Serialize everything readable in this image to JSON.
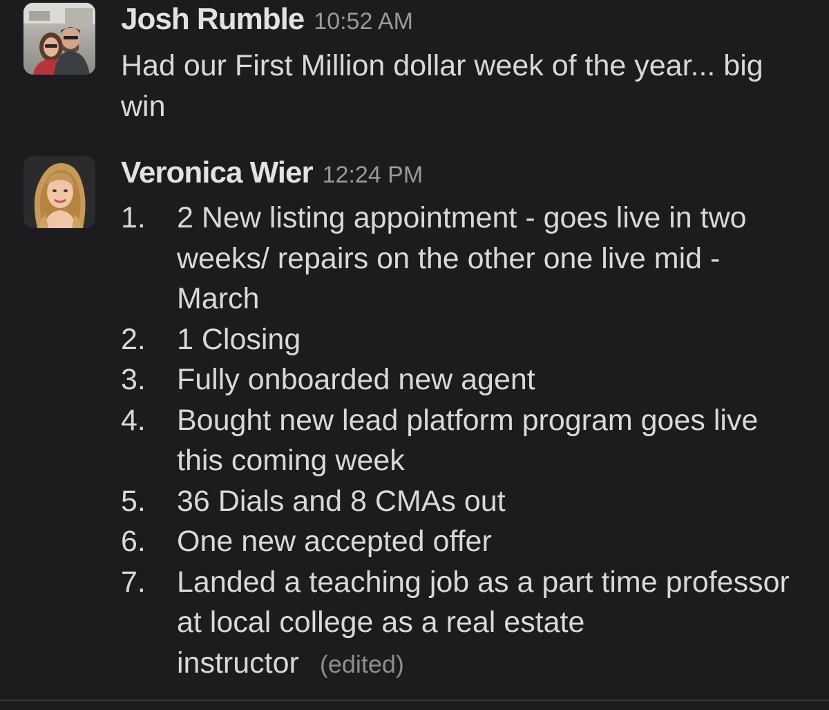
{
  "messages": [
    {
      "sender": "Josh Rumble",
      "time": "10:52 AM",
      "text": "Had our First Million dollar week of the year... big win"
    },
    {
      "sender": "Veronica Wier",
      "time": "12:24 PM",
      "items": [
        {
          "num": "1.",
          "text": "2 New listing appointment - goes live in two weeks/ repairs on the other one live mid - March"
        },
        {
          "num": "2.",
          "text": "1 Closing"
        },
        {
          "num": "3.",
          "text": "Fully onboarded new agent"
        },
        {
          "num": "4.",
          "text": "Bought new lead platform program goes live this coming week"
        },
        {
          "num": "5.",
          "text": "36 Dials and 8 CMAs out"
        },
        {
          "num": "6.",
          "text": "One new accepted offer"
        },
        {
          "num": "7.",
          "text": "Landed a teaching job as a part time professor at local college as a real estate instructor"
        }
      ],
      "edited_label": "(edited)"
    }
  ]
}
